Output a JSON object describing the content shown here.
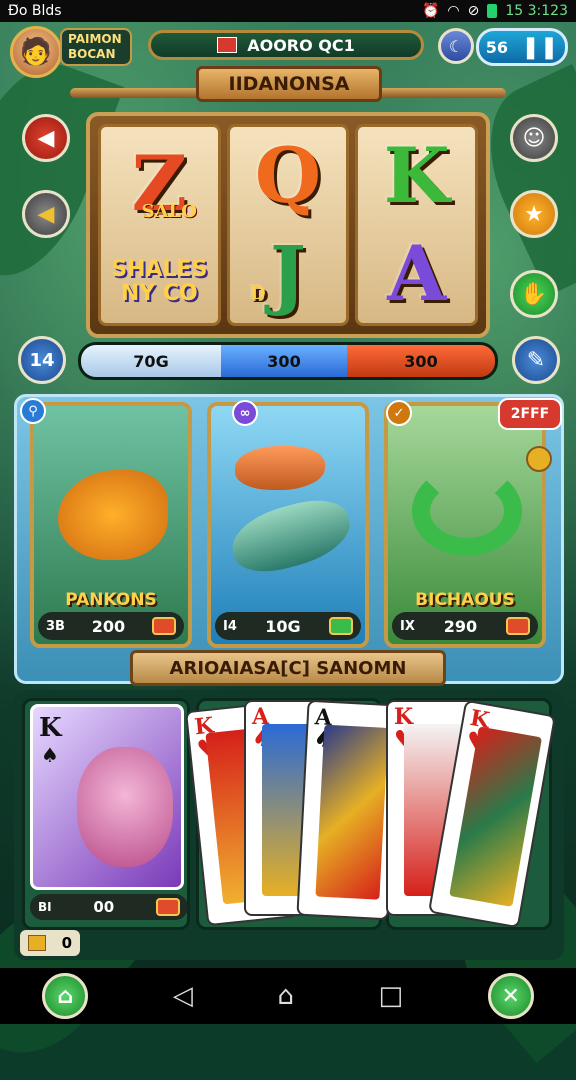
{
  "status_bar": {
    "left": "Ð̃o Blds",
    "time": "15 3:123"
  },
  "player": {
    "line1": "PAIMON",
    "line2": "BOCAN"
  },
  "top_bar": {
    "label": "AOORO QC1"
  },
  "coins": {
    "value": "56"
  },
  "title": "IIDANONSA",
  "reels": [
    {
      "top": "Z",
      "top_tag": "SALO",
      "bottom_line1": "SHALES",
      "bottom_line2": "NY CO"
    },
    {
      "top": "Q",
      "bottom": "J",
      "bottom_tag": "D"
    },
    {
      "top": "K",
      "bottom": "A"
    }
  ],
  "left_badge": "14",
  "progress": {
    "seg1": "70G",
    "seg2": "300",
    "seg3": "300"
  },
  "fish_cards": [
    {
      "name": "PANKONS",
      "icon_tag": "3B",
      "value": "200"
    },
    {
      "name": "",
      "icon_tag": "I4",
      "value": "10G"
    },
    {
      "name": "BICHAOUS",
      "icon_tag": "IX",
      "value": "290",
      "badge": "2FFF"
    }
  ],
  "section_title": "ARIOAIASA[C] SANOMN",
  "hand_card": {
    "rank": "K",
    "footer_tag": "BI",
    "value": "00"
  },
  "cards": [
    {
      "rank": "K",
      "suit": "♥"
    },
    {
      "rank": "A",
      "suit": "♠"
    },
    {
      "rank": "A",
      "suit": "♠"
    },
    {
      "rank": "K",
      "suit": "♥"
    },
    {
      "rank": "K",
      "suit": "♥"
    }
  ],
  "bottom_tag": "0",
  "colors": {
    "gold": "#c69a45",
    "red_btn": "#d63a2e",
    "green_btn": "#3bbb4a",
    "blue_btn": "#2a7bd6"
  }
}
